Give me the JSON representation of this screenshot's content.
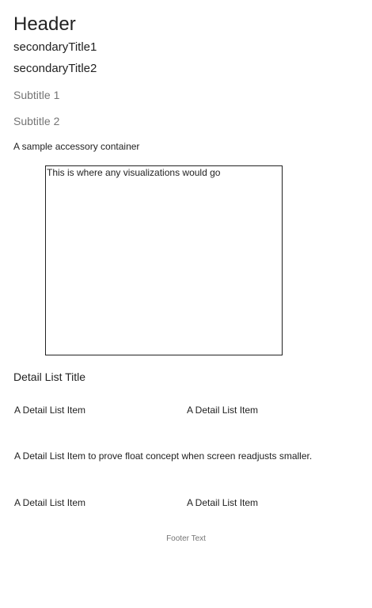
{
  "header": {
    "title": "Header"
  },
  "secondary_titles": [
    "secondaryTitle1",
    "secondaryTitle2"
  ],
  "subtitles": [
    "Subtitle 1",
    "Subtitle 2"
  ],
  "accessory": {
    "caption": "A sample accessory container",
    "visualization_placeholder": "This is where any visualizations would go"
  },
  "detail_list": {
    "title": "Detail List Title",
    "items": [
      "A Detail List Item",
      "A Detail List Item",
      "A Detail List Item to prove float concept when screen readjusts smaller.",
      "A Detail List Item",
      "A Detail List Item"
    ]
  },
  "footer": {
    "text": "Footer Text"
  }
}
